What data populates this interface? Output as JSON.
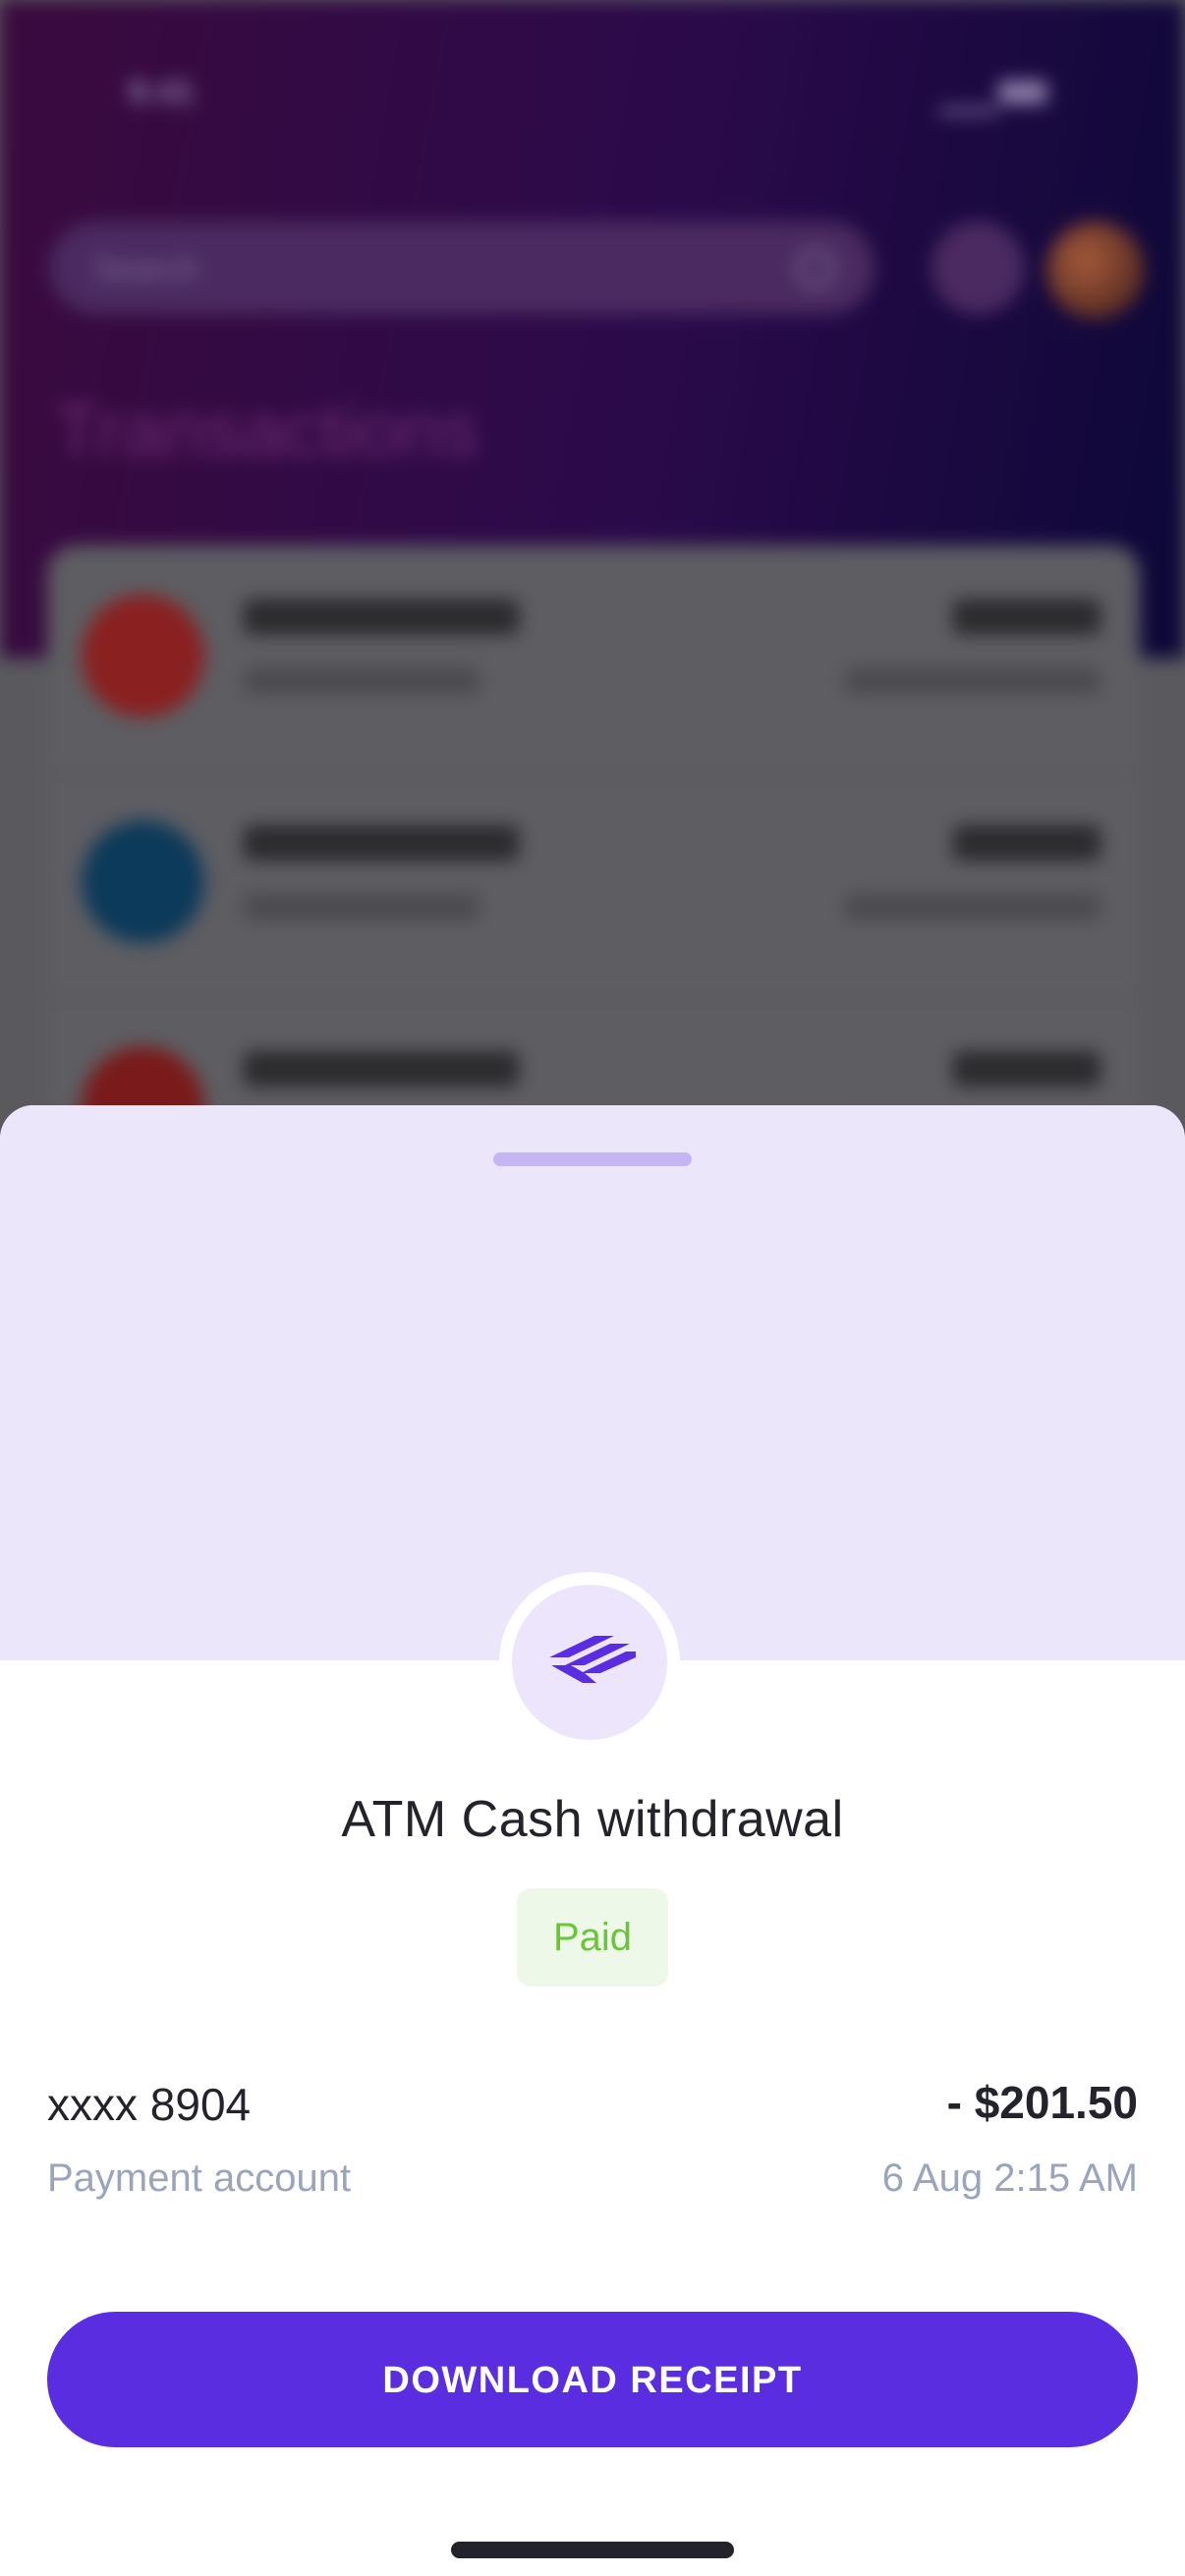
{
  "background_screen": {
    "status_time": "9:41",
    "search_placeholder": "Search",
    "title": "Transactions"
  },
  "sheet": {
    "merchant_logo": "bank-stripes-logo",
    "title": "ATM Cash withdrawal",
    "status": "Paid",
    "account": "xxxx 8904",
    "account_label": "Payment account",
    "amount": "- $201.50",
    "datetime": "6 Aug 2:15 AM",
    "button_label": "DOWNLOAD RECEIPT"
  },
  "colors": {
    "accent": "#5a2ee0",
    "sheet_header": "#ece6fb",
    "paid_green": "#6bc43a",
    "paid_bg": "#eef8e9"
  }
}
